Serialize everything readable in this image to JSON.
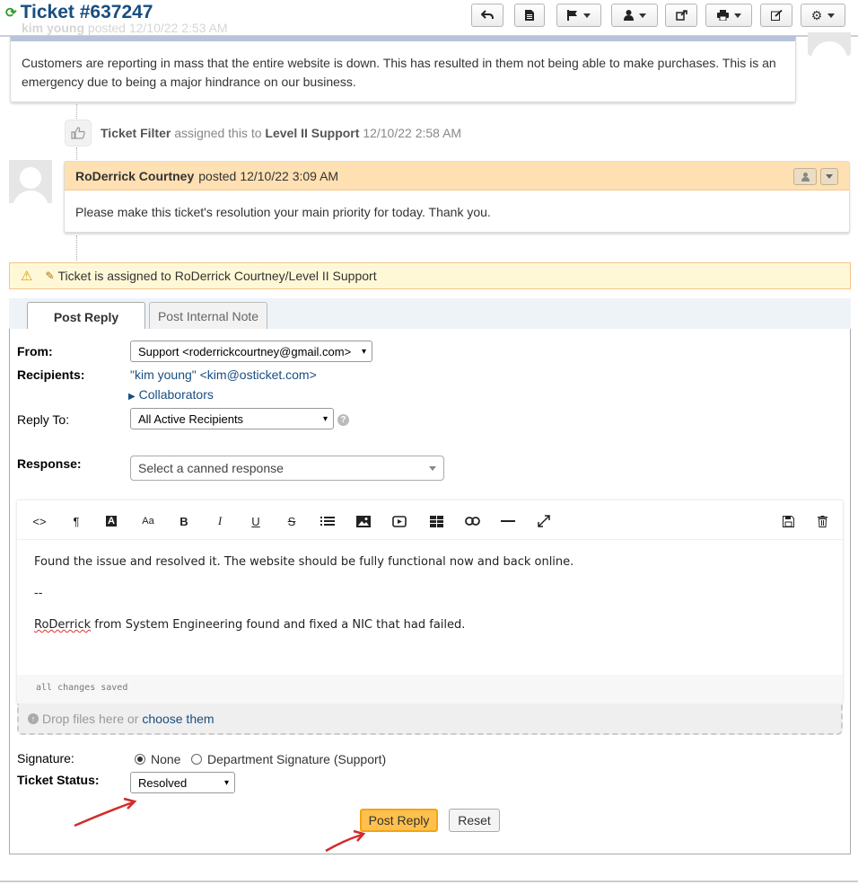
{
  "header": {
    "title": "Ticket #637247",
    "toolbar": [
      {
        "icon": "reply-icon",
        "dropdown": false
      },
      {
        "icon": "document-icon",
        "dropdown": false
      },
      {
        "icon": "flag-icon",
        "dropdown": true
      },
      {
        "icon": "user-icon",
        "dropdown": true
      },
      {
        "icon": "share-icon",
        "dropdown": false
      },
      {
        "icon": "print-icon",
        "dropdown": true
      },
      {
        "icon": "edit-icon",
        "dropdown": false
      },
      {
        "icon": "gear-icon",
        "dropdown": true
      }
    ]
  },
  "thread": {
    "message1": {
      "author": "kim young",
      "action": "posted",
      "time": "12/10/22 2:53 AM",
      "body": "Customers are reporting in mass that the entire website is down. This has resulted in them not being able to make purchases. This is an emergency due to being a major hindrance on our business."
    },
    "event": {
      "actor": "Ticket Filter",
      "action": "assigned this to",
      "target": "Level II Support",
      "time": "12/10/22 2:58 AM"
    },
    "response": {
      "author": "RoDerrick Courtney",
      "action": "posted",
      "time": "12/10/22 3:09 AM",
      "body": "Please make this ticket's resolution your main priority for today. Thank you."
    }
  },
  "alert": {
    "text": "Ticket is assigned to RoDerrick Courtney/Level II Support"
  },
  "tabs": [
    {
      "label": "Post Reply",
      "active": true
    },
    {
      "label": "Post Internal Note",
      "active": false
    }
  ],
  "reply_form": {
    "from_label": "From:",
    "from_value": "Support <roderrickcourtney@gmail.com>",
    "recipients_label": "Recipients:",
    "recipients_value": "\"kim young\" <kim@osticket.com>",
    "collaborators_label": "Collaborators",
    "reply_to_label": "Reply To:",
    "reply_to_value": "All Active Recipients",
    "response_label": "Response:",
    "canned_placeholder": "Select a canned response",
    "editor": {
      "line1": "Found the issue and resolved it. The website should be fully functional now and back online.",
      "line2": "--",
      "line3_name": "RoDerrick",
      "line3_rest": " from System Engineering found and fixed a NIC that had failed.",
      "status": "all changes saved"
    },
    "dropzone_text": "Drop files here or",
    "dropzone_link": "choose them",
    "signature_label": "Signature:",
    "signature_options": [
      "None",
      "Department Signature (Support)"
    ],
    "signature_selected": "None",
    "status_label": "Ticket Status:",
    "status_value": "Resolved",
    "post_button": "Post Reply",
    "reset_button": "Reset"
  },
  "colors": {
    "title": "#184e81",
    "response_header": "#ffe0b3",
    "alert_bg": "#fff8d6",
    "primary_button": "#ffc04d",
    "annotation_arrow": "#d42a2a"
  }
}
